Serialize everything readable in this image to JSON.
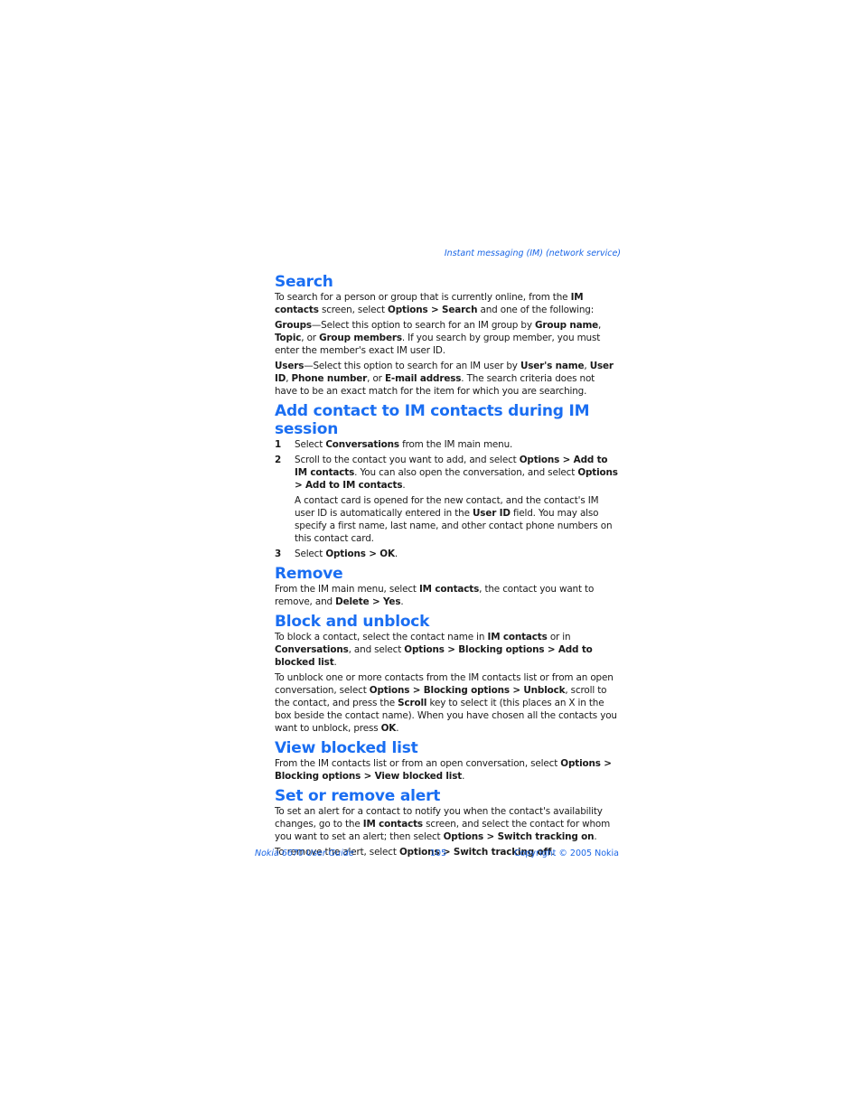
{
  "running_head": "Instant messaging (IM) (network service)",
  "sections": {
    "search": {
      "title": "Search",
      "p1": [
        {
          "t": "To search for a person or group that is currently online, from the "
        },
        {
          "t": "IM contacts",
          "b": true
        },
        {
          "t": " screen, select "
        },
        {
          "t": "Options > Search",
          "b": true
        },
        {
          "t": " and one of the following:"
        }
      ],
      "p2": [
        {
          "t": "Groups",
          "b": true
        },
        {
          "t": "—Select this option to search for an IM group by "
        },
        {
          "t": "Group name",
          "b": true
        },
        {
          "t": ", "
        },
        {
          "t": "Topic",
          "b": true
        },
        {
          "t": ", or "
        },
        {
          "t": "Group members",
          "b": true
        },
        {
          "t": ". If you search by group member, you must enter the member's exact IM user ID."
        }
      ],
      "p3": [
        {
          "t": "Users",
          "b": true
        },
        {
          "t": "—Select this option to search for an IM user by "
        },
        {
          "t": "User's name",
          "b": true
        },
        {
          "t": ", "
        },
        {
          "t": "User ID",
          "b": true
        },
        {
          "t": ", "
        },
        {
          "t": "Phone number",
          "b": true
        },
        {
          "t": ", or "
        },
        {
          "t": "E-mail address",
          "b": true
        },
        {
          "t": ". The search criteria does not have to be an exact match for the item for which you are searching."
        }
      ]
    },
    "add_contact": {
      "title": "Add contact to IM contacts during IM session",
      "steps": [
        {
          "num": "1",
          "text": [
            {
              "t": "Select "
            },
            {
              "t": "Conversations",
              "b": true
            },
            {
              "t": " from the IM main menu."
            }
          ]
        },
        {
          "num": "2",
          "text": [
            {
              "t": "Scroll to the contact you want to add, and select "
            },
            {
              "t": "Options > Add to IM contacts",
              "b": true
            },
            {
              "t": ". You can also open the conversation, and select "
            },
            {
              "t": "Options > Add to IM contacts",
              "b": true
            },
            {
              "t": "."
            }
          ]
        },
        {
          "num": "3",
          "text": [
            {
              "t": "Select "
            },
            {
              "t": "Options > OK",
              "b": true
            },
            {
              "t": "."
            }
          ]
        }
      ],
      "note": [
        {
          "t": "A contact card is opened for the new contact, and the contact's IM user ID is automatically entered in the "
        },
        {
          "t": "User ID",
          "b": true
        },
        {
          "t": " field. You may also specify a first name, last name, and other contact phone numbers on this contact card."
        }
      ]
    },
    "remove": {
      "title": "Remove",
      "p1": [
        {
          "t": "From the IM main menu, select "
        },
        {
          "t": "IM contacts",
          "b": true
        },
        {
          "t": ", the contact you want to remove, and "
        },
        {
          "t": "Delete > Yes",
          "b": true
        },
        {
          "t": "."
        }
      ]
    },
    "block": {
      "title": "Block and unblock",
      "p1": [
        {
          "t": "To block a contact, select the contact name in "
        },
        {
          "t": "IM contacts",
          "b": true
        },
        {
          "t": " or in "
        },
        {
          "t": "Conversations",
          "b": true
        },
        {
          "t": ", and select "
        },
        {
          "t": "Options > Blocking options > Add to blocked list",
          "b": true
        },
        {
          "t": "."
        }
      ],
      "p2": [
        {
          "t": "To unblock one or more contacts from the IM contacts list or from an open conversation, select "
        },
        {
          "t": "Options > Blocking options > Unblock",
          "b": true
        },
        {
          "t": ", scroll to the contact, and press the "
        },
        {
          "t": "Scroll",
          "b": true
        },
        {
          "t": " key to select it (this places an X in the box beside the contact name). When you have chosen all the contacts you want to unblock, press "
        },
        {
          "t": "OK",
          "b": true
        },
        {
          "t": "."
        }
      ]
    },
    "view_blocked": {
      "title": "View blocked list",
      "p1": [
        {
          "t": "From the IM contacts list or from an open conversation, select "
        },
        {
          "t": "Options > Blocking options > View blocked list",
          "b": true
        },
        {
          "t": "."
        }
      ]
    },
    "alert": {
      "title": "Set or remove alert",
      "p1": [
        {
          "t": "To set an alert for a contact to notify you when the contact's availability changes, go to the "
        },
        {
          "t": "IM contacts",
          "b": true
        },
        {
          "t": " screen, and select the contact for whom you want to set an alert; then select "
        },
        {
          "t": "Options > Switch tracking on",
          "b": true
        },
        {
          "t": "."
        }
      ],
      "p2": [
        {
          "t": "To remove the alert, select "
        },
        {
          "t": "Options > Switch tracking off",
          "b": true
        },
        {
          "t": "."
        }
      ]
    }
  },
  "footer": {
    "left": "Nokia 6670 User Guide",
    "page_number": "105",
    "right": "Copyright © 2005 Nokia"
  },
  "colors": {
    "heading": "#1a6ef2",
    "accent": "#1a66e6"
  }
}
